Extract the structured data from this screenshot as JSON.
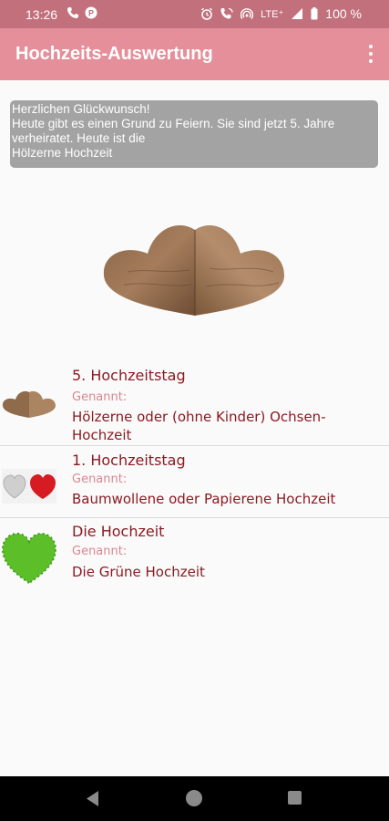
{
  "status_bar": {
    "time": "13:26",
    "network": "LTE⁺",
    "battery": "100 %"
  },
  "app_bar": {
    "title": "Hochzeits-Auswertung",
    "menu_icon": "more-vert-icon"
  },
  "congrats": {
    "text": "Herzlichen Glückwunsch!\nHeute gibt es einen Grund zu Feiern. Sie sind jetzt 5. Jahre verheiratet. Heute ist die\nHölzerne Hochzeit"
  },
  "list": [
    {
      "title": "5. Hochzeitstag",
      "label": "Genannt:",
      "value": "Hölzerne oder (ohne Kinder) Ochsen-Hochzeit",
      "image": "wooden-hearts"
    },
    {
      "title": "1. Hochzeitstag",
      "label": "Genannt:",
      "value": "Baumwollene oder Papierene Hochzeit",
      "image": "cotton-paper-hearts"
    },
    {
      "title": "Die Hochzeit",
      "label": "Genannt:",
      "value": "Die Grüne Hochzeit",
      "image": "green-heart"
    }
  ],
  "colors": {
    "status_bar": "#c2707c",
    "app_bar": "#e48f99",
    "accent_text": "#8b1a22",
    "label_text": "#d98791"
  }
}
